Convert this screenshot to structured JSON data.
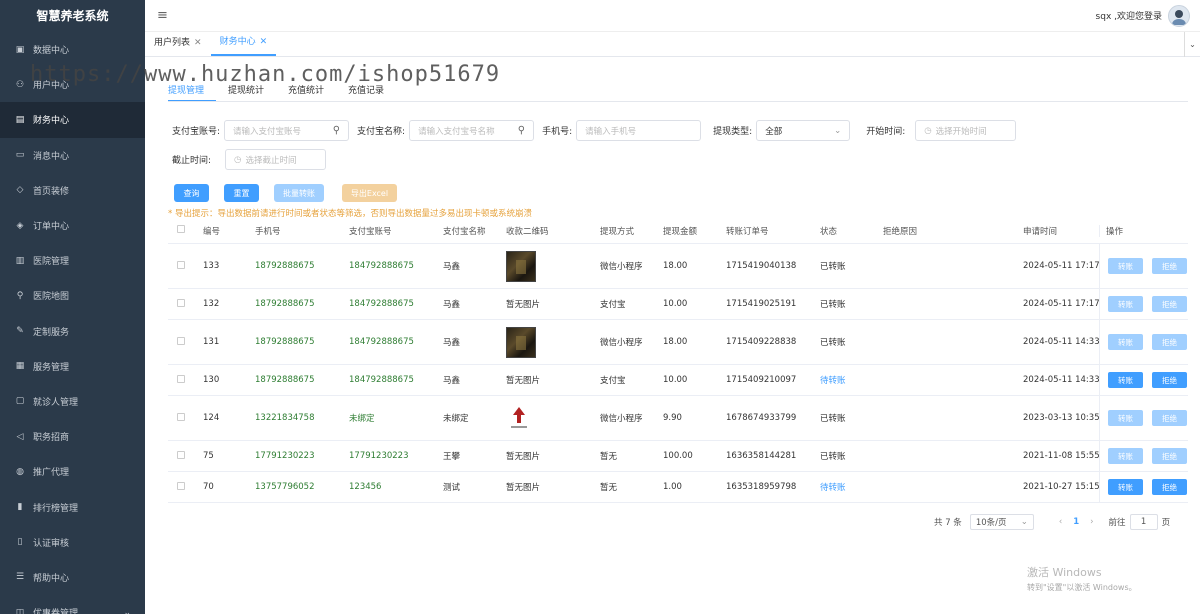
{
  "app": {
    "title": "智慧养老系统"
  },
  "sidebar": {
    "items": [
      {
        "label": "数据中心",
        "icon": "chart-icon",
        "glyph": "▣"
      },
      {
        "label": "用户中心",
        "icon": "user-icon",
        "glyph": "⚇"
      },
      {
        "label": "财务中心",
        "icon": "wallet-icon",
        "glyph": "▤"
      },
      {
        "label": "消息中心",
        "icon": "message-icon",
        "glyph": "▭"
      },
      {
        "label": "首页装修",
        "icon": "cube-icon",
        "glyph": "◇"
      },
      {
        "label": "订单中心",
        "icon": "box-icon",
        "glyph": "◈"
      },
      {
        "label": "医院管理",
        "icon": "hospital-icon",
        "glyph": "▥"
      },
      {
        "label": "医院地图",
        "icon": "location-icon",
        "glyph": "⚲"
      },
      {
        "label": "定制服务",
        "icon": "edit-icon",
        "glyph": "✎"
      },
      {
        "label": "服务管理",
        "icon": "clipboard-icon",
        "glyph": "▦"
      },
      {
        "label": "就诊人管理",
        "icon": "briefcase-icon",
        "glyph": "▢"
      },
      {
        "label": "职务招商",
        "icon": "megaphone-icon",
        "glyph": "◁"
      },
      {
        "label": "推广代理",
        "icon": "globe-icon",
        "glyph": "◍"
      },
      {
        "label": "排行榜管理",
        "icon": "bar-chart-icon",
        "glyph": "▮"
      },
      {
        "label": "认证审核",
        "icon": "document-icon",
        "glyph": "▯"
      },
      {
        "label": "帮助中心",
        "icon": "list-icon",
        "glyph": "☰"
      },
      {
        "label": "优惠券管理",
        "icon": "coupon-icon",
        "glyph": "◫"
      }
    ]
  },
  "header": {
    "user_text": "sqx ,欢迎您登录",
    "menu_glyph": "≡"
  },
  "page_tabs": [
    {
      "label": "用户列表"
    },
    {
      "label": "财务中心"
    }
  ],
  "watermark": "https://www.huzhan.com/ishop51679",
  "sub_tabs": [
    "提现管理",
    "提现统计",
    "充值统计",
    "充值记录"
  ],
  "filters": {
    "alipay_account_label": "支付宝账号:",
    "alipay_account_placeholder": "请输入支付宝账号",
    "alipay_name_label": "支付宝名称:",
    "alipay_name_placeholder": "请输入支付宝号名称",
    "phone_label": "手机号:",
    "phone_placeholder": "请输入手机号",
    "type_label": "提现类型:",
    "type_value": "全部",
    "start_label": "开始时间:",
    "start_placeholder": "选择开始时间",
    "end_label": "截止时间:",
    "end_placeholder": "选择截止时间"
  },
  "actions": {
    "query": "查询",
    "reset": "重置",
    "batch": "批量转账",
    "export": "导出Excel"
  },
  "tip": "* 导出提示：导出数据前请进行时间或者状态等筛选，否则导出数据量过多易出现卡顿或系统崩溃",
  "table": {
    "headers": [
      "编号",
      "手机号",
      "支付宝账号",
      "支付宝名称",
      "收款二维码",
      "提现方式",
      "提现金额",
      "转账订单号",
      "状态",
      "拒绝原因",
      "申请时间",
      "操作"
    ],
    "rows": [
      {
        "id": "133",
        "phone": "18792888675",
        "account": "184792888675",
        "name": "马鑫",
        "qr": "photo",
        "qr_text": "",
        "method": "微信小程序",
        "amount": "18.00",
        "order": "1715419040138",
        "status": "已转账",
        "status_link": false,
        "reason": "",
        "time": "2024-05-11 17:17",
        "active": false
      },
      {
        "id": "132",
        "phone": "18792888675",
        "account": "184792888675",
        "name": "马鑫",
        "qr": "text",
        "qr_text": "暂无图片",
        "method": "支付宝",
        "amount": "10.00",
        "order": "1715419025191",
        "status": "已转账",
        "status_link": false,
        "reason": "",
        "time": "2024-05-11 17:17",
        "active": false
      },
      {
        "id": "131",
        "phone": "18792888675",
        "account": "184792888675",
        "name": "马鑫",
        "qr": "photo",
        "qr_text": "",
        "method": "微信小程序",
        "amount": "18.00",
        "order": "1715409228838",
        "status": "已转账",
        "status_link": false,
        "reason": "",
        "time": "2024-05-11 14:33",
        "active": false
      },
      {
        "id": "130",
        "phone": "18792888675",
        "account": "184792888675",
        "name": "马鑫",
        "qr": "text",
        "qr_text": "暂无图片",
        "method": "支付宝",
        "amount": "10.00",
        "order": "1715409210097",
        "status": "待转账",
        "status_link": true,
        "reason": "",
        "time": "2024-05-11 14:33",
        "active": true
      },
      {
        "id": "124",
        "phone": "13221834758",
        "account": "未绑定",
        "name": "未绑定",
        "qr": "logo",
        "qr_text": "",
        "method": "微信小程序",
        "amount": "9.90",
        "order": "1678674933799",
        "status": "已转账",
        "status_link": false,
        "reason": "",
        "time": "2023-03-13 10:35",
        "active": false
      },
      {
        "id": "75",
        "phone": "17791230223",
        "account": "17791230223",
        "name": "王攀",
        "qr": "text",
        "qr_text": "暂无图片",
        "method": "暂无",
        "amount": "100.00",
        "order": "1636358144281",
        "status": "已转账",
        "status_link": false,
        "reason": "",
        "time": "2021-11-08 15:55",
        "active": false
      },
      {
        "id": "70",
        "phone": "13757796052",
        "account": "123456",
        "name": "测试",
        "qr": "text",
        "qr_text": "暂无图片",
        "method": "暂无",
        "amount": "1.00",
        "order": "1635318959798",
        "status": "待转账",
        "status_link": true,
        "reason": "",
        "time": "2021-10-27 15:15",
        "active": true
      }
    ],
    "op_transfer": "转账",
    "op_reject": "拒绝"
  },
  "pagination": {
    "total": "共 7 条",
    "page_size": "10条/页",
    "current": "1",
    "goto_label": "前往",
    "goto_value": "1",
    "page_suffix": "页"
  },
  "windows_notice": {
    "line1": "激活 Windows",
    "line2": "转到\"设置\"以激活 Windows。"
  },
  "colors": {
    "primary": "#409eff",
    "sidebar_bg": "#2b3a4a",
    "warning": "#e6a23c",
    "green_text": "#2e7d32"
  }
}
